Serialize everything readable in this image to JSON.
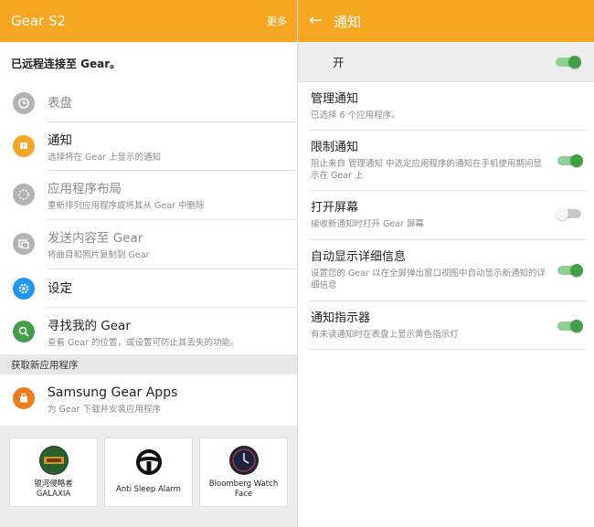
{
  "left": {
    "appbar": {
      "title": "Gear S2",
      "more": "更多"
    },
    "connection": "已远程连接至 Gear。",
    "items": [
      {
        "title": "表盘",
        "subtitle": "",
        "icon": "watch-face-icon",
        "dim": true
      },
      {
        "title": "通知",
        "subtitle": "选择将在 Gear 上显示的通知",
        "icon": "notification-icon",
        "dim": false
      },
      {
        "title": "应用程序布局",
        "subtitle": "重新排列应用程序或将其从 Gear 中删除",
        "icon": "apps-layout-icon",
        "dim": true
      },
      {
        "title": "发送内容至 Gear",
        "subtitle": "将曲目和照片复制到 Gear",
        "icon": "send-content-icon",
        "dim": true
      },
      {
        "title": "设定",
        "subtitle": "",
        "icon": "gear-icon",
        "dim": false
      },
      {
        "title": "寻找我的 Gear",
        "subtitle": "查看 Gear 的位置，或设置可防止其丢失的功能。",
        "icon": "find-gear-icon",
        "dim": false
      }
    ],
    "category": "获取新应用程序",
    "store": {
      "title": "Samsung Gear Apps",
      "subtitle": "为 Gear 下载并安装应用程序"
    },
    "cards": [
      {
        "name": "银河侵略者\nGALAXIA",
        "icon": "galaxia-logo"
      },
      {
        "name": "Anti Sleep Alarm",
        "icon": "steering-wheel-icon"
      },
      {
        "name": "Bloomberg Watch\nFace",
        "icon": "watch-face-icon"
      }
    ]
  },
  "right": {
    "appbar": {
      "title": "通知"
    },
    "master": {
      "label": "开",
      "on": true
    },
    "settings": [
      {
        "title": "管理通知",
        "subtitle": "已选择 6 个应用程序。",
        "has_toggle": false
      },
      {
        "title": "限制通知",
        "subtitle": "阻止来自 管理通知 中选定应用程序的通知在手机使用期间显示在 Gear 上",
        "has_toggle": true,
        "on": true
      },
      {
        "title": "打开屏幕",
        "subtitle": "接收新通知时打开 Gear 屏幕",
        "has_toggle": true,
        "on": false
      },
      {
        "title": "自动显示详细信息",
        "subtitle": "设置您的 Gear 以在全屏弹出窗口视图中自动显示新通知的详细信息",
        "has_toggle": true,
        "on": true
      },
      {
        "title": "通知指示器",
        "subtitle": "有未读通知时在表盘上显示黄色指示灯",
        "has_toggle": true,
        "on": true
      }
    ]
  },
  "colors": {
    "accent": "#f5a623",
    "toggle_on": "#43a047",
    "settings_blue": "#2196f3"
  }
}
